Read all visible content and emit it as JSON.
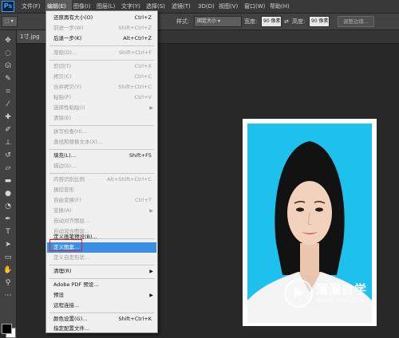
{
  "menubar": {
    "logo": "Ps",
    "items": [
      "文件(F)",
      "编辑(E)",
      "图像(I)",
      "图层(L)",
      "文字(Y)",
      "选择(S)",
      "滤镜(T)",
      "3D(D)",
      "视图(V)",
      "窗口(W)",
      "帮助(H)"
    ],
    "active_index": 1
  },
  "options": {
    "style_label": "样式:",
    "style_value": "固定大小",
    "width_label": "宽度:",
    "width_value": "90 像素",
    "height_label": "高度:",
    "height_value": "90 像素",
    "refine_edge": "调整边缘..."
  },
  "document": {
    "tab": "1寸.jpg"
  },
  "edit_menu": {
    "items": [
      {
        "label": "还原再有大小(O)",
        "shortcut": "Ctrl+Z",
        "disabled": false
      },
      {
        "label": "前进一步(W)",
        "shortcut": "Shift+Ctrl+Z",
        "disabled": true
      },
      {
        "label": "后退一步(K)",
        "shortcut": "Alt+Ctrl+Z",
        "disabled": false
      },
      {
        "label": "渐隐(D)...",
        "shortcut": "Shift+Ctrl+F",
        "disabled": true
      },
      {
        "label": "剪切(T)",
        "shortcut": "Ctrl+X",
        "disabled": true
      },
      {
        "label": "拷贝(C)",
        "shortcut": "Ctrl+C",
        "disabled": true
      },
      {
        "label": "合并拷贝(Y)",
        "shortcut": "Shift+Ctrl+C",
        "disabled": true
      },
      {
        "label": "粘贴(P)",
        "shortcut": "Ctrl+V",
        "disabled": true
      },
      {
        "label": "选择性粘贴(I)",
        "shortcut": "",
        "disabled": true,
        "submenu": true
      },
      {
        "label": "清除(E)",
        "shortcut": "",
        "disabled": true
      },
      {
        "label": "拼写检查(H)...",
        "shortcut": "",
        "disabled": true
      },
      {
        "label": "查找和替换文本(X)...",
        "shortcut": "",
        "disabled": true
      },
      {
        "label": "填充(L)...",
        "shortcut": "Shift+F5",
        "disabled": false
      },
      {
        "label": "描边(S)...",
        "shortcut": "",
        "disabled": true
      },
      {
        "label": "内容识别比例",
        "shortcut": "Alt+Shift+Ctrl+C",
        "disabled": true
      },
      {
        "label": "操控变形",
        "shortcut": "",
        "disabled": true
      },
      {
        "label": "自由变换(F)",
        "shortcut": "Ctrl+T",
        "disabled": true
      },
      {
        "label": "变换(A)",
        "shortcut": "",
        "disabled": true,
        "submenu": true
      },
      {
        "label": "自动对齐图层...",
        "shortcut": "",
        "disabled": true
      },
      {
        "label": "自动混合图层...",
        "shortcut": "",
        "disabled": true
      },
      {
        "label": "定义画笔预设(B)...",
        "shortcut": "",
        "disabled": false
      },
      {
        "label": "定义图案...",
        "shortcut": "",
        "disabled": false,
        "highlighted": true
      },
      {
        "label": "定义自定形状...",
        "shortcut": "",
        "disabled": true
      },
      {
        "label": "清理(R)",
        "shortcut": "",
        "disabled": false,
        "submenu": true
      },
      {
        "label": "Adobe PDF 预设...",
        "shortcut": "",
        "disabled": false
      },
      {
        "label": "预设",
        "shortcut": "",
        "disabled": false,
        "submenu": true
      },
      {
        "label": "远程连接...",
        "shortcut": "",
        "disabled": false
      },
      {
        "label": "颜色设置(G)...",
        "shortcut": "Shift+Ctrl+K",
        "disabled": false
      },
      {
        "label": "指定配置文件...",
        "shortcut": "",
        "disabled": false
      }
    ]
  },
  "watermark": {
    "title": "溜溜自学",
    "subtitle": "ZIXUE.3D66.COM"
  },
  "colors": {
    "photo_background": "#1ec0ee",
    "menu_highlight": "#3a8ee6",
    "annotation_box": "#e2231a"
  }
}
